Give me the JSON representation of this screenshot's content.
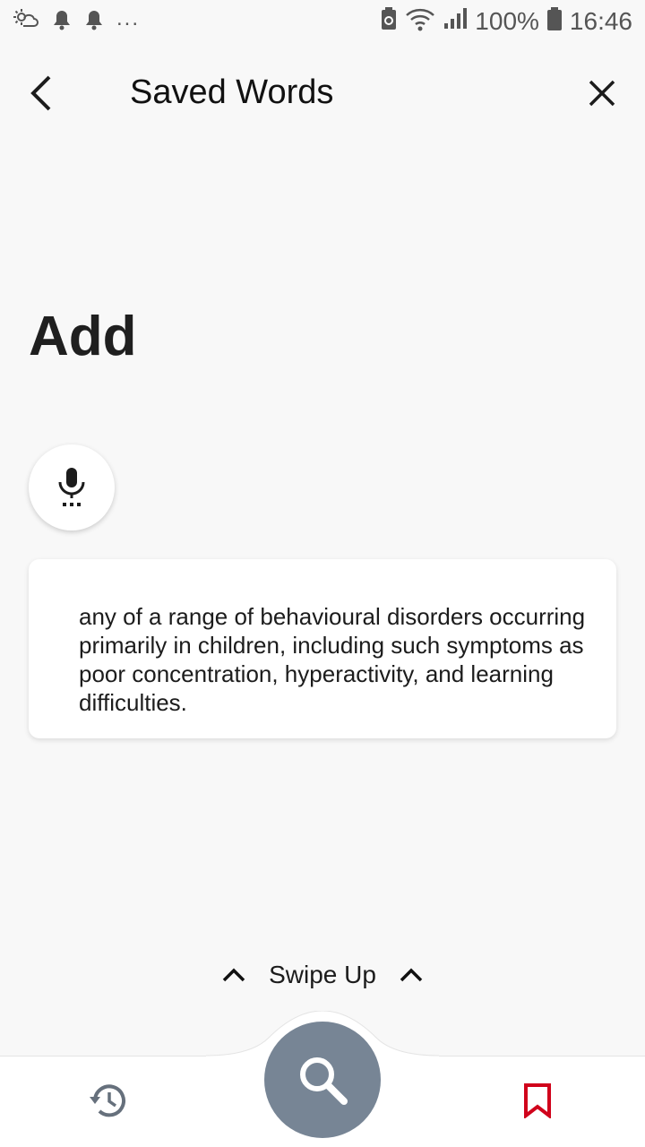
{
  "status_bar": {
    "battery_text": "100%",
    "time": "16:46",
    "icons": [
      "weather-icon",
      "notification-bell-icon",
      "notification-bell-icon",
      "more-dots-icon",
      "battery-saver-icon",
      "wifi-icon",
      "signal-icon",
      "battery-icon"
    ],
    "more_text": "..."
  },
  "app_bar": {
    "title": "Saved Words",
    "back_icon": "chevron-left-icon",
    "close_icon": "close-icon"
  },
  "word": {
    "heading": "Add"
  },
  "mic": {
    "icon": "microphone-icon"
  },
  "definition": {
    "text": "any of a range of behavioural disorders occurring primarily in children, including such symptoms as poor concentration, hyperactivity, and learning difficulties."
  },
  "swipe": {
    "label": "Swipe Up"
  },
  "bottom_nav": {
    "history_icon": "history-icon",
    "search_icon": "search-icon",
    "bookmark_icon": "bookmark-icon",
    "colors": {
      "fab": "#778595",
      "bookmark": "#d0021b"
    }
  }
}
